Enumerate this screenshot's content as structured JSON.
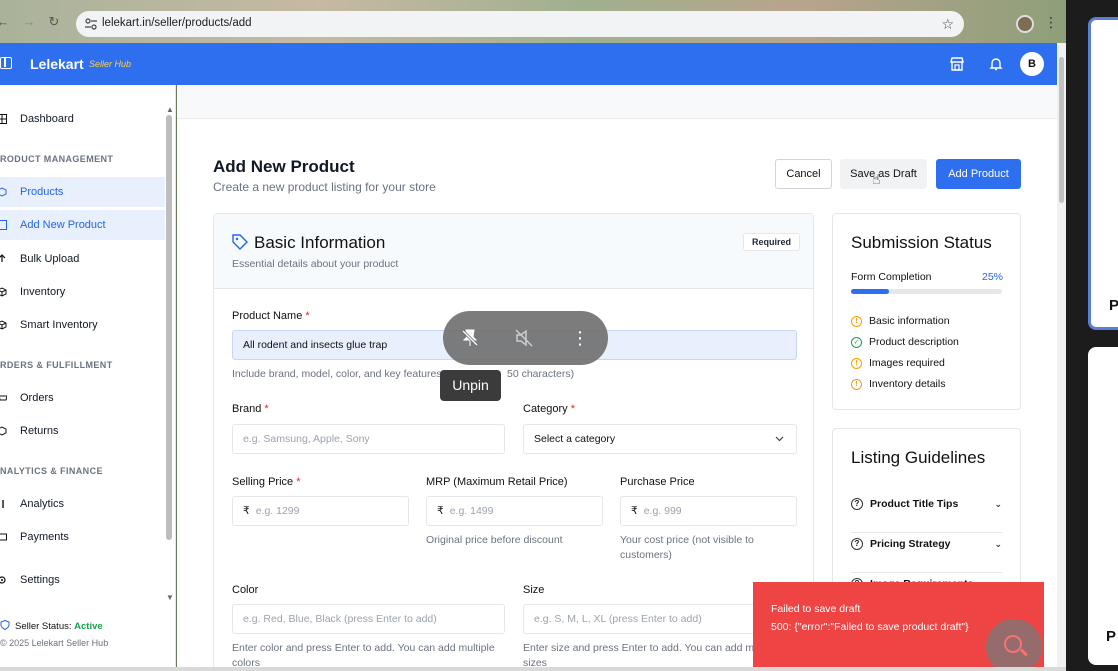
{
  "browser": {
    "url": "lelekart.in/seller/products/add"
  },
  "header": {
    "brand": "Lelekart",
    "brand_sub": "Seller Hub",
    "avatar_initial": "B"
  },
  "sidebar": {
    "items": [
      {
        "label": "Dashboard"
      },
      {
        "label": "Products"
      },
      {
        "label": "Add New Product"
      },
      {
        "label": "Bulk Upload"
      },
      {
        "label": "Inventory"
      },
      {
        "label": "Smart Inventory"
      },
      {
        "label": "Orders"
      },
      {
        "label": "Returns"
      },
      {
        "label": "Analytics"
      },
      {
        "label": "Payments"
      },
      {
        "label": "Settings"
      }
    ],
    "sections": [
      "RODUCT MANAGEMENT",
      "RDERS & FULFILLMENT",
      "NALYTICS & FINANCE"
    ],
    "seller_status_label": "Seller Status:",
    "seller_status_value": "Active",
    "copyright": "© 2025 Lelekart Seller Hub"
  },
  "page": {
    "title": "Add New Product",
    "subtitle": "Create a new product listing for your store",
    "cancel_label": "Cancel",
    "draft_label": "Save as Draft",
    "add_label": "Add Product"
  },
  "basic_info": {
    "title": "Basic Information",
    "desc": "Essential details about your product",
    "badge": "Required",
    "product_name_label": "Product Name",
    "product_name_value": "All rodent and insects glue trap",
    "product_name_hint_a": "Include brand, model, color, and key features",
    "product_name_hint_b": "50 characters)",
    "brand_label": "Brand",
    "brand_placeholder": "e.g. Samsung, Apple, Sony",
    "category_label": "Category",
    "category_value": "Select a category",
    "selling_price_label": "Selling Price",
    "selling_price_placeholder": "e.g. 1299",
    "mrp_label": "MRP (Maximum Retail Price)",
    "mrp_placeholder": "e.g. 1499",
    "mrp_hint": "Original price before discount",
    "purchase_label": "Purchase Price",
    "purchase_placeholder": "e.g. 999",
    "purchase_hint": "Your cost price (not visible to customers)",
    "color_label": "Color",
    "color_placeholder": "e.g. Red, Blue, Black (press Enter to add)",
    "color_hint": "Enter color and press Enter to add. You can add multiple colors",
    "size_label": "Size",
    "size_placeholder": "e.g. S, M, L, XL (press Enter to add)",
    "size_hint": "Enter size and press Enter to add. You can add mu sizes",
    "rupee": "₹",
    "required_mark": "*"
  },
  "submission": {
    "title": "Submission Status",
    "completion_label": "Form Completion",
    "completion_pct_text": "25%",
    "completion_value": 0.25,
    "items": [
      {
        "label": "Basic information",
        "status": "warning"
      },
      {
        "label": "Product description",
        "status": "done"
      },
      {
        "label": "Images required",
        "status": "warning"
      },
      {
        "label": "Inventory details",
        "status": "warning"
      }
    ]
  },
  "guidelines": {
    "title": "Listing Guidelines",
    "items": [
      {
        "label": "Product Title Tips"
      },
      {
        "label": "Pricing Strategy"
      },
      {
        "label": "Image Requirements"
      }
    ]
  },
  "overlay": {
    "unpin_label": "Unpin"
  },
  "toast": {
    "title": "Failed to save draft",
    "message": "500: {\"error\":\"Failed to save product draft\"}"
  },
  "external_panel": {
    "label_1": "P",
    "label_2": "P"
  },
  "colors": {
    "primary": "#2e6ff0",
    "danger": "#ef4444",
    "success": "#16a34a",
    "warning": "#f59e0b"
  }
}
